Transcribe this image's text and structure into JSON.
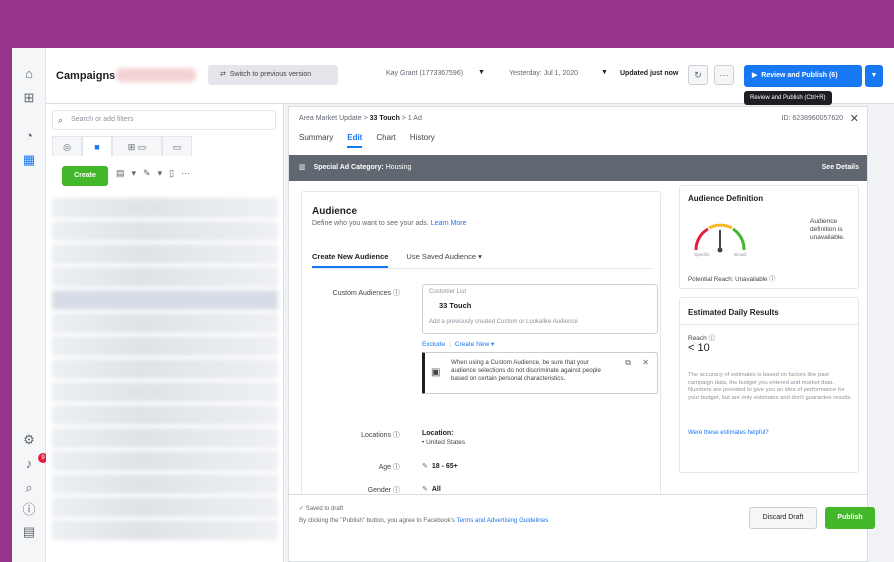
{
  "app": {
    "title": "Campaigns",
    "switch_label": "Switch to previous version",
    "account": "Kay Grant (1773367596)",
    "date": "Yesterday: Jul 1, 2020",
    "updated": "Updated just now",
    "review_label": "Review and Publish (6)",
    "tooltip": "Review and Publish (Ctrl+R)"
  },
  "left_panel": {
    "search_placeholder": "Search or add filters",
    "create_label": "Create"
  },
  "breadcrumb": {
    "part1": "Area Market Update",
    "part2": "33 Touch",
    "part3": "1 Ad",
    "id": "ID: 6238960057620"
  },
  "tabs": [
    "Summary",
    "Edit",
    "Chart",
    "History"
  ],
  "banner": {
    "label": "Special Ad Category:",
    "value": "Housing",
    "see_details": "See Details"
  },
  "audience": {
    "title": "Audience",
    "subtitle": "Define who you want to see your ads.",
    "learn_more": "Learn More",
    "tab_create": "Create New Audience",
    "tab_saved": "Use Saved Audience ▾",
    "custom_label": "Custom Audiences",
    "ca_type": "Customer List",
    "ca_name": "33 Touch",
    "ca_placeholder": "Add a previously created Custom or Lookalike Audience",
    "exclude": "Exclude",
    "create_new": "Create New ▾",
    "notice": "When using a Custom Audience, be sure that your audience selections do not discriminate against people based on certain personal characteristics.",
    "locations_label": "Locations",
    "location_title": "Location:",
    "location_value": "• United States",
    "age_label": "Age",
    "age_value": "18 - 65+",
    "gender_label": "Gender",
    "gender_value": "All"
  },
  "audience_definition": {
    "title": "Audience Definition",
    "gauge_left": "Specific",
    "gauge_right": "Broad",
    "status": "Audience definition is unavailable.",
    "potential": "Potential Reach: Unavailable"
  },
  "estimated": {
    "title": "Estimated Daily Results",
    "reach_label": "Reach",
    "reach_value": "< 10",
    "disclaimer": "The accuracy of estimates is based on factors like past campaign data, the budget you entered and market data. Numbers are provided to give you an idea of performance for your budget, but are only estimates and don't guarantee results.",
    "link": "Were these estimates helpful?"
  },
  "footer": {
    "saved": "✓ Saved to draft",
    "terms_prefix": "By clicking the \"Publish\" button, you agree to Facebook's",
    "terms_link": "Terms and Advertising Guidelines",
    "discard": "Discard Draft",
    "publish": "Publish"
  },
  "colors": {
    "brand_blue": "#1877f2",
    "publish_green": "#42b72a",
    "frame_border": "#97338a"
  }
}
